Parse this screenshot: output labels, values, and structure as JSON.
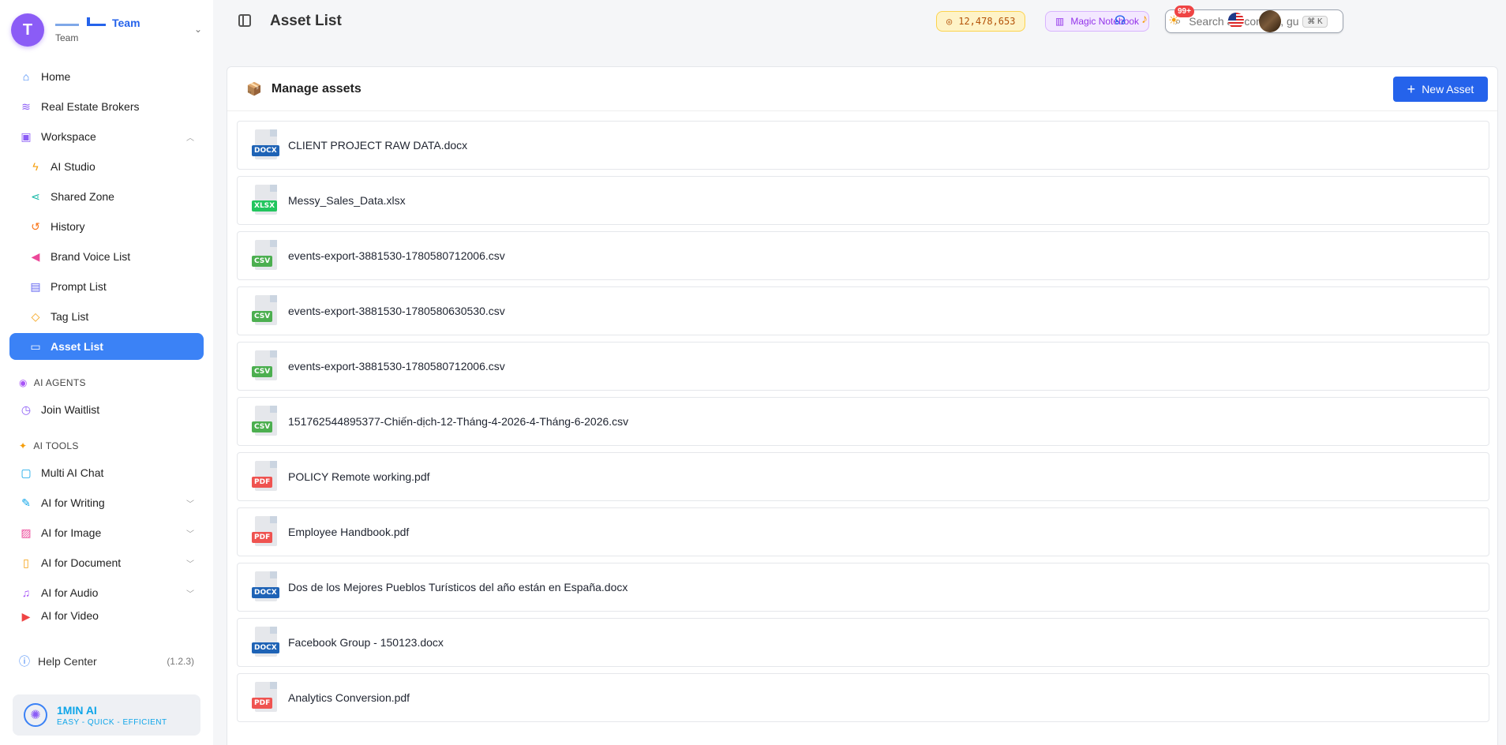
{
  "team": {
    "avatar_letter": "T",
    "name": "Team",
    "subtitle": "Team"
  },
  "sidebar": {
    "items": [
      {
        "label": "Home",
        "icon": "home-icon",
        "color": "#3b82f6"
      },
      {
        "label": "Real Estate Brokers",
        "icon": "layers-icon",
        "color": "#8b5cf6"
      },
      {
        "label": "Workspace",
        "icon": "briefcase-icon",
        "color": "#8b5cf6"
      },
      {
        "label": "AI Studio",
        "icon": "bolt-icon",
        "color": "#f59e0b"
      },
      {
        "label": "Shared Zone",
        "icon": "share-icon",
        "color": "#14b8a6"
      },
      {
        "label": "History",
        "icon": "history-icon",
        "color": "#f97316"
      },
      {
        "label": "Brand Voice List",
        "icon": "megaphone-icon",
        "color": "#ec4899"
      },
      {
        "label": "Prompt List",
        "icon": "document-icon",
        "color": "#6366f1"
      },
      {
        "label": "Tag List",
        "icon": "tag-icon",
        "color": "#f59e0b"
      },
      {
        "label": "Asset List",
        "icon": "folder-icon",
        "color": "#ffffff"
      }
    ],
    "agents_section": "AI AGENTS",
    "agents_items": [
      {
        "label": "Join Waitlist",
        "icon": "clock-icon"
      }
    ],
    "tools_section": "AI TOOLS",
    "tools_items": [
      {
        "label": "Multi AI Chat",
        "icon": "chat-icon"
      },
      {
        "label": "AI for Writing",
        "icon": "pen-icon"
      },
      {
        "label": "AI for Image",
        "icon": "image-icon"
      },
      {
        "label": "AI for Document",
        "icon": "file-icon"
      },
      {
        "label": "AI for Audio",
        "icon": "music-icon"
      },
      {
        "label": "AI for Video",
        "icon": "video-icon"
      }
    ],
    "help": "Help Center",
    "version": "(1.2.3)",
    "brand_name": "1MIN AI",
    "brand_tagline": "EASY - QUICK - EFFICIENT"
  },
  "header": {
    "title": "Asset List",
    "credits": "12,478,653",
    "magic": "Magic Notebook",
    "search_placeholder": "Search all: content, guides...",
    "search_shortcut": "⌘ K",
    "notif_badge": "99+"
  },
  "panel": {
    "title": "Manage assets",
    "new_button": "New Asset"
  },
  "assets": [
    {
      "name": "CLIENT PROJECT RAW DATA.docx",
      "type": "DOCX",
      "cls": "docx"
    },
    {
      "name": "Messy_Sales_Data.xlsx",
      "type": "XLSX",
      "cls": "xlsx"
    },
    {
      "name": "events-export-3881530-1780580712006.csv",
      "type": "CSV",
      "cls": "csv"
    },
    {
      "name": "events-export-3881530-1780580630530.csv",
      "type": "CSV",
      "cls": "csv"
    },
    {
      "name": "events-export-3881530-1780580712006.csv",
      "type": "CSV",
      "cls": "csv"
    },
    {
      "name": "151762544895377-Chiến-dịch-12-Tháng-4-2026-4-Tháng-6-2026.csv",
      "type": "CSV",
      "cls": "csv"
    },
    {
      "name": "POLICY Remote working.pdf",
      "type": "PDF",
      "cls": "pdf"
    },
    {
      "name": "Employee Handbook.pdf",
      "type": "PDF",
      "cls": "pdf"
    },
    {
      "name": "Dos de los Mejores Pueblos Turísticos del año están en España.docx",
      "type": "DOCX",
      "cls": "docx"
    },
    {
      "name": "Facebook Group - 150123.docx",
      "type": "DOCX",
      "cls": "docx"
    },
    {
      "name": "Analytics Conversion.pdf",
      "type": "PDF",
      "cls": "pdf"
    }
  ]
}
